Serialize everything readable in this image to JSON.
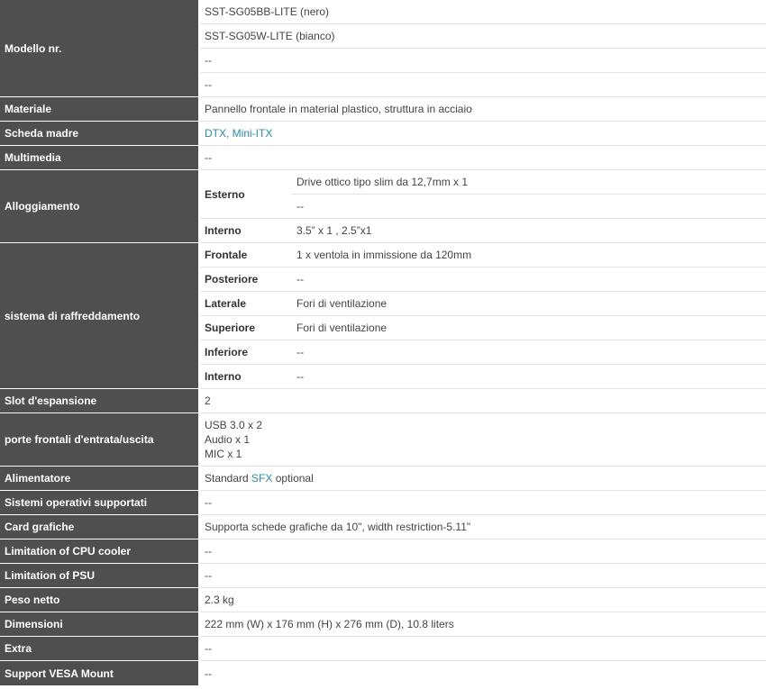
{
  "rows": {
    "modello": {
      "label": "Modello nr.",
      "values": [
        "SST-SG05BB-LITE (nero)",
        "SST-SG05W-LITE (bianco)",
        "--",
        "--"
      ]
    },
    "materiale": {
      "label": "Materiale",
      "value": "Pannello frontale in material plastico, struttura in acciaio"
    },
    "scheda": {
      "label": "Scheda madre",
      "link": "DTX, Mini-ITX"
    },
    "multimedia": {
      "label": "Multimedia",
      "value": "--"
    },
    "alloggiamento": {
      "label": "Alloggiamento",
      "esterno_label": "Esterno",
      "esterno_values": [
        "Drive ottico tipo slim da 12,7mm x 1",
        "--"
      ],
      "interno_label": "Interno",
      "interno_value": "3.5” x 1 , 2.5”x1"
    },
    "raffreddamento": {
      "label": "sistema di raffreddamento",
      "items": [
        {
          "label": "Frontale",
          "value": "1 x ventola in immissione da 120mm"
        },
        {
          "label": "Posteriore",
          "value": "--"
        },
        {
          "label": "Laterale",
          "value": "Fori di ventilazione"
        },
        {
          "label": "Superiore",
          "value": "Fori di ventilazione"
        },
        {
          "label": "Inferiore",
          "value": "--"
        },
        {
          "label": "Interno",
          "value": "--"
        }
      ]
    },
    "slot": {
      "label": "Slot d'espansione",
      "value": "2"
    },
    "porte": {
      "label": "porte frontali d'entrata/uscita",
      "lines": [
        "USB 3.0 x 2",
        "Audio x 1",
        "MIC x 1"
      ]
    },
    "alimentatore": {
      "label": "Alimentatore",
      "prefix": "Standard ",
      "link": "SFX",
      "suffix": " optional"
    },
    "sistemi": {
      "label": "Sistemi operativi supportati",
      "value": "--"
    },
    "card": {
      "label": "Card grafiche",
      "value": "Supporta schede grafiche da 10\", width restriction-5.11\""
    },
    "cpu": {
      "label": "Limitation of CPU cooler",
      "value": "--"
    },
    "psu": {
      "label": "Limitation of PSU",
      "value": "--"
    },
    "peso": {
      "label": "Peso netto",
      "value": "2.3 kg"
    },
    "dimensioni": {
      "label": "Dimensioni",
      "value": "222 mm (W) x 176 mm (H) x 276 mm (D), 10.8 liters"
    },
    "extra": {
      "label": "Extra",
      "value": "--"
    },
    "vesa": {
      "label": "Support VESA Mount",
      "value": "--"
    }
  }
}
